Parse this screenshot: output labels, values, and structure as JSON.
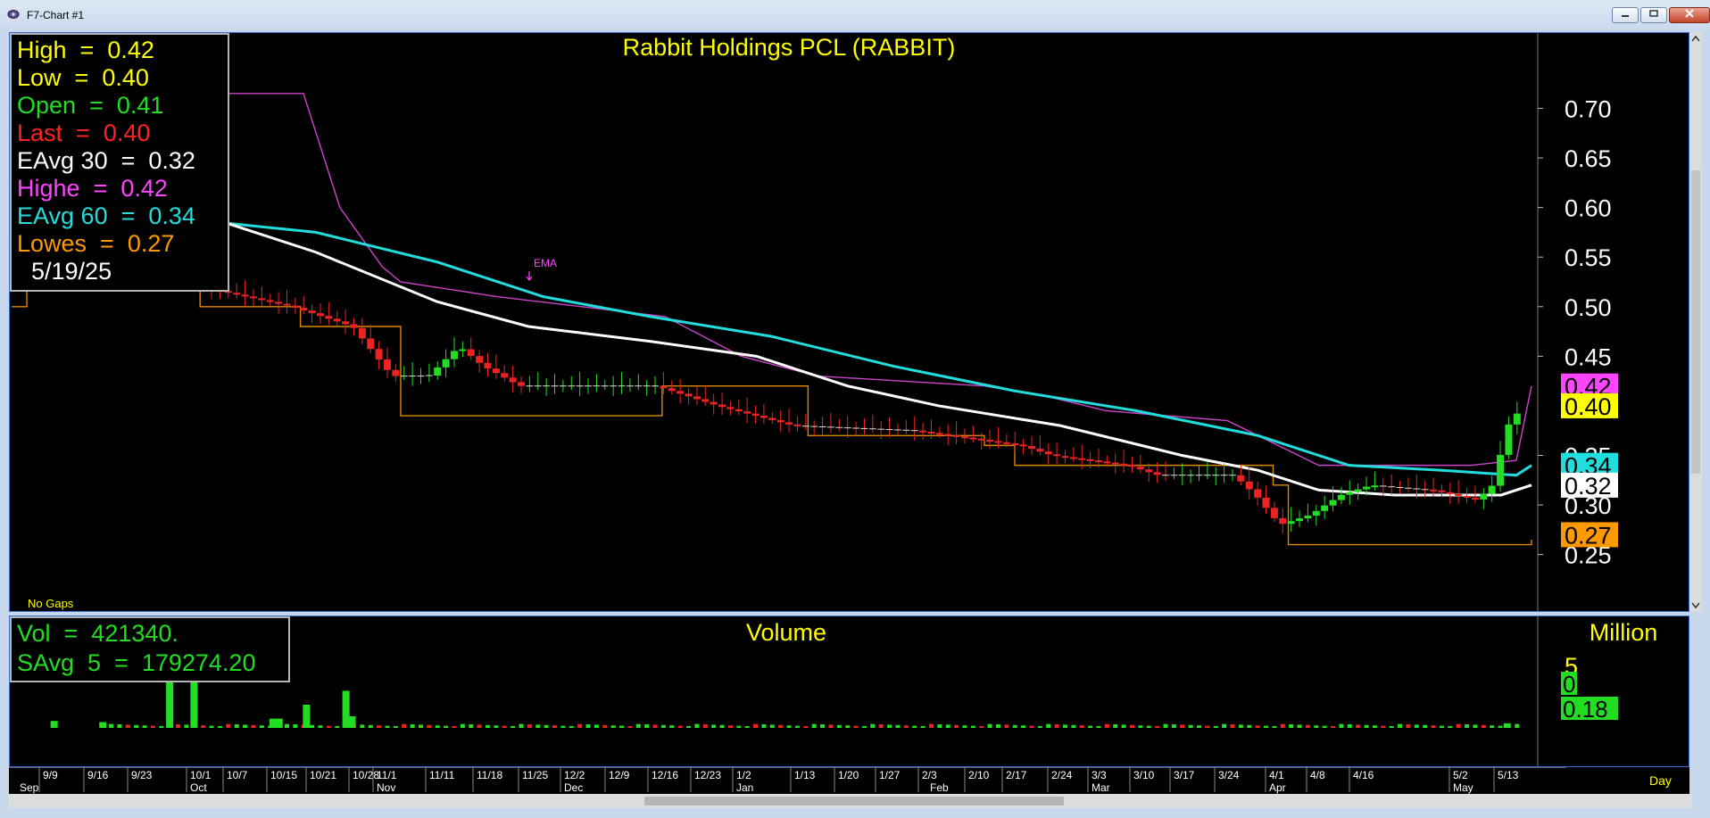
{
  "window": {
    "title": "F7-Chart #1"
  },
  "chart_data": [
    {
      "type": "candlestick",
      "title": "Rabbit Holdings PCL  (RABBIT)",
      "price_axis": {
        "ticks": [
          "0.70",
          "0.65",
          "0.60",
          "0.55",
          "0.50",
          "0.45",
          "0.35",
          "0.30",
          "0.25"
        ],
        "range": [
          0.22,
          0.74
        ]
      },
      "price_flags": [
        {
          "label": "0.42",
          "value": 0.42,
          "color": "#ff44ff"
        },
        {
          "label": "0.40",
          "value": 0.4,
          "color": "#ffff00"
        },
        {
          "label": "0.34",
          "value": 0.34,
          "color": "#22dddd"
        },
        {
          "label": "0.32",
          "value": 0.32,
          "color": "#ffffff"
        },
        {
          "label": "0.27",
          "value": 0.27,
          "color": "#ff9900"
        }
      ],
      "annotation": "EMA",
      "footer_note": "No Gaps",
      "legend": [
        {
          "name": "High",
          "value": "0.42",
          "color": "#ffff00"
        },
        {
          "name": "Low",
          "value": "0.40",
          "color": "#ffff00"
        },
        {
          "name": "Open",
          "value": "0.41",
          "color": "#22dd22"
        },
        {
          "name": "Last",
          "value": "0.40",
          "color": "#ff2222"
        },
        {
          "name": "EAvg 30",
          "value": "0.32",
          "color": "#ffffff"
        },
        {
          "name": "Highe",
          "value": "0.42",
          "color": "#ff44ff"
        },
        {
          "name": "EAvg 60",
          "value": "0.34",
          "color": "#22dddd"
        },
        {
          "name": "Lowes",
          "value": "0.27",
          "color": "#ff9900"
        }
      ],
      "legend_date": "5/19/25",
      "series_colors": {
        "up": "#22dd22",
        "down": "#ee2222",
        "ema30": "#ffffff",
        "ema60": "#22dddd",
        "highest": "#cc44cc",
        "lowest": "#dd8800"
      },
      "close_path": [
        [
          0,
          0.595
        ],
        [
          25,
          0.6
        ],
        [
          37,
          0.62
        ],
        [
          40,
          0.68
        ],
        [
          44,
          0.66
        ],
        [
          50,
          0.6
        ],
        [
          57,
          0.55
        ],
        [
          65,
          0.52
        ],
        [
          80,
          0.51
        ],
        [
          95,
          0.5
        ],
        [
          115,
          0.48
        ],
        [
          128,
          0.43
        ],
        [
          140,
          0.43
        ],
        [
          150,
          0.46
        ],
        [
          158,
          0.44
        ],
        [
          170,
          0.42
        ],
        [
          190,
          0.42
        ],
        [
          215,
          0.42
        ],
        [
          235,
          0.4
        ],
        [
          260,
          0.38
        ],
        [
          300,
          0.375
        ],
        [
          335,
          0.36
        ],
        [
          345,
          0.35
        ],
        [
          370,
          0.34
        ],
        [
          380,
          0.33
        ],
        [
          405,
          0.33
        ],
        [
          412,
          0.31
        ],
        [
          420,
          0.28
        ],
        [
          430,
          0.29
        ],
        [
          440,
          0.31
        ],
        [
          450,
          0.32
        ],
        [
          470,
          0.315
        ],
        [
          485,
          0.305
        ],
        [
          490,
          0.32
        ],
        [
          495,
          0.38
        ],
        [
          500,
          0.4
        ]
      ],
      "ema30_path": [
        [
          0,
          0.585
        ],
        [
          45,
          0.595
        ],
        [
          70,
          0.585
        ],
        [
          100,
          0.555
        ],
        [
          140,
          0.505
        ],
        [
          170,
          0.48
        ],
        [
          210,
          0.465
        ],
        [
          245,
          0.45
        ],
        [
          275,
          0.42
        ],
        [
          305,
          0.4
        ],
        [
          345,
          0.38
        ],
        [
          385,
          0.35
        ],
        [
          410,
          0.335
        ],
        [
          430,
          0.315
        ],
        [
          455,
          0.31
        ],
        [
          490,
          0.31
        ],
        [
          500,
          0.32
        ]
      ],
      "ema60_path": [
        [
          0,
          0.565
        ],
        [
          40,
          0.575
        ],
        [
          68,
          0.585
        ],
        [
          100,
          0.575
        ],
        [
          140,
          0.545
        ],
        [
          175,
          0.51
        ],
        [
          210,
          0.49
        ],
        [
          250,
          0.47
        ],
        [
          290,
          0.44
        ],
        [
          330,
          0.415
        ],
        [
          370,
          0.395
        ],
        [
          410,
          0.37
        ],
        [
          440,
          0.34
        ],
        [
          470,
          0.335
        ],
        [
          495,
          0.33
        ],
        [
          500,
          0.34
        ]
      ],
      "highest_path": [
        [
          0,
          0.61
        ],
        [
          36,
          0.61
        ],
        [
          40,
          0.715
        ],
        [
          96,
          0.715
        ],
        [
          108,
          0.6
        ],
        [
          122,
          0.54
        ],
        [
          128,
          0.525
        ],
        [
          160,
          0.51
        ],
        [
          215,
          0.49
        ],
        [
          240,
          0.45
        ],
        [
          265,
          0.43
        ],
        [
          320,
          0.42
        ],
        [
          340,
          0.41
        ],
        [
          360,
          0.395
        ],
        [
          400,
          0.385
        ],
        [
          430,
          0.34
        ],
        [
          480,
          0.34
        ],
        [
          495,
          0.345
        ],
        [
          500,
          0.42
        ]
      ],
      "lowest_path": [
        [
          0,
          0.5
        ],
        [
          5,
          0.52
        ],
        [
          36,
          0.59
        ],
        [
          52,
          0.55
        ],
        [
          62,
          0.5
        ],
        [
          95,
          0.48
        ],
        [
          122,
          0.48
        ],
        [
          128,
          0.39
        ],
        [
          210,
          0.39
        ],
        [
          214,
          0.42
        ],
        [
          255,
          0.42
        ],
        [
          262,
          0.37
        ],
        [
          320,
          0.36
        ],
        [
          330,
          0.34
        ],
        [
          415,
          0.32
        ],
        [
          420,
          0.26
        ],
        [
          500,
          0.265
        ]
      ],
      "x_range": [
        0,
        500
      ]
    },
    {
      "type": "bar",
      "title": "Volume",
      "unit_label": "Million",
      "axis_ticks": [
        "5"
      ],
      "legend": [
        {
          "name": "Vol",
          "value": "421340."
        },
        {
          "name": "SAvg  5",
          "value": "179274.20"
        }
      ],
      "flags": [
        {
          "label": "0",
          "color": "#22dd22"
        },
        {
          "label": "0.18",
          "color": "#22dd22"
        }
      ],
      "spikes": [
        {
          "x": 52,
          "value": 4.0
        },
        {
          "x": 60,
          "value": 4.0
        },
        {
          "x": 97,
          "value": 2.0
        },
        {
          "x": 110,
          "value": 3.2
        },
        {
          "x": 112,
          "value": 1.0
        },
        {
          "x": 86,
          "value": 0.8
        },
        {
          "x": 88,
          "value": 0.8
        },
        {
          "x": 14,
          "value": 0.6
        },
        {
          "x": 30,
          "value": 0.5
        },
        {
          "x": 492,
          "value": 0.4
        }
      ],
      "x_range": [
        0,
        500
      ]
    }
  ],
  "time_axis": {
    "days": [
      "9/9",
      "9/16",
      "9/23",
      "10/1",
      "10/7",
      "10/15",
      "10/21",
      "10/28",
      "11/1",
      "11/11",
      "11/18",
      "11/25",
      "12/2",
      "12/9",
      "12/16",
      "12/23",
      "1/2",
      "1/13",
      "1/20",
      "1/27",
      "2/3",
      "2/10",
      "2/17",
      "2/24",
      "3/3",
      "3/10",
      "3/17",
      "3/24",
      "4/1",
      "4/8",
      "4/16",
      "5/2",
      "5/13"
    ],
    "months": [
      "Sep",
      "Oct",
      "Nov",
      "Dec",
      "Jan",
      "Feb",
      "Mar",
      "Apr",
      "May"
    ],
    "periodicity": "Day"
  }
}
